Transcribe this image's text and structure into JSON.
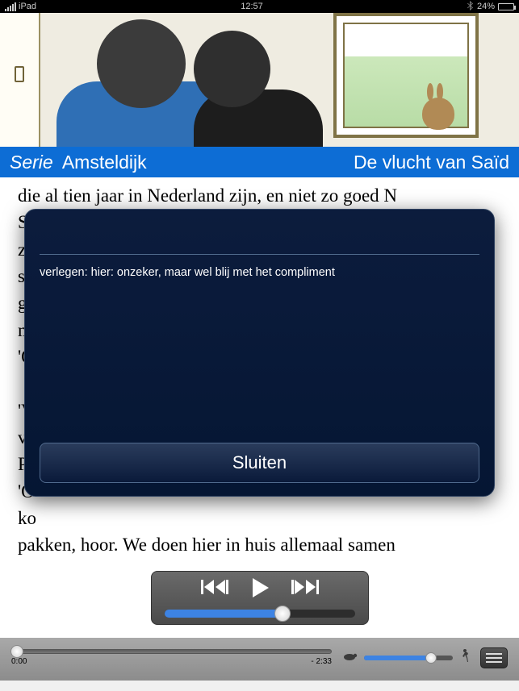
{
  "statusbar": {
    "carrier": "iPad",
    "time": "12:57",
    "battery_pct": "24%"
  },
  "header": {
    "serie_prefix": "Serie",
    "serie_name": "Amsteldijk",
    "book_title": "De vlucht van Saïd"
  },
  "reader": {
    "paragraph": "die al tien jaar in Nederland zijn, en niet zo goed N\nSa\nze\nsp\ngi\nm\n'O\n\n'V\nva\nPe\n'O\nko\npakken, hoor. We doen hier in huis allemaal samen"
  },
  "popup": {
    "definition": "verlegen: hier: onzeker, maar wel blij met het compliment",
    "close_label": "Sluiten"
  },
  "player": {
    "elapsed": "0:00",
    "remaining": "- 2:33",
    "progress_fraction": 0.015,
    "speed_fraction": 0.75,
    "miniplayer_progress_fraction": 0.62
  }
}
